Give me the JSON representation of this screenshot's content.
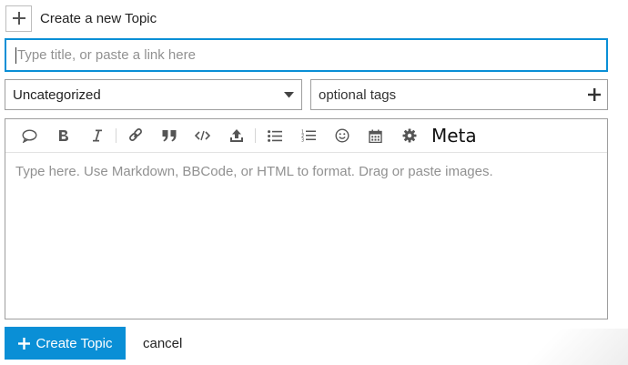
{
  "header": {
    "title": "Create a new Topic",
    "icon": "plus-icon"
  },
  "title_input": {
    "placeholder": "Type title, or paste a link here",
    "value": ""
  },
  "category_select": {
    "selected": "Uncategorized",
    "icon": "caret-down-icon"
  },
  "tags_input": {
    "placeholder": "optional tags",
    "icon": "plus-icon"
  },
  "toolbar": {
    "buttons": [
      {
        "name": "quote-bubble-icon"
      },
      {
        "name": "bold-icon"
      },
      {
        "name": "italic-icon"
      },
      {
        "name": "link-icon"
      },
      {
        "name": "blockquote-icon"
      },
      {
        "name": "code-icon"
      },
      {
        "name": "upload-icon"
      },
      {
        "name": "bullet-list-icon"
      },
      {
        "name": "numbered-list-icon"
      },
      {
        "name": "emoji-icon"
      },
      {
        "name": "calendar-icon"
      },
      {
        "name": "gear-icon"
      }
    ],
    "meta_label": "Meta"
  },
  "editor": {
    "placeholder": "Type here. Use Markdown, BBCode, or HTML to format. Drag or paste images."
  },
  "actions": {
    "create_label": "Create Topic",
    "cancel_label": "cancel"
  },
  "colors": {
    "accent": "#0a8fd6",
    "border": "#9e9e9e",
    "placeholder": "#919191"
  }
}
